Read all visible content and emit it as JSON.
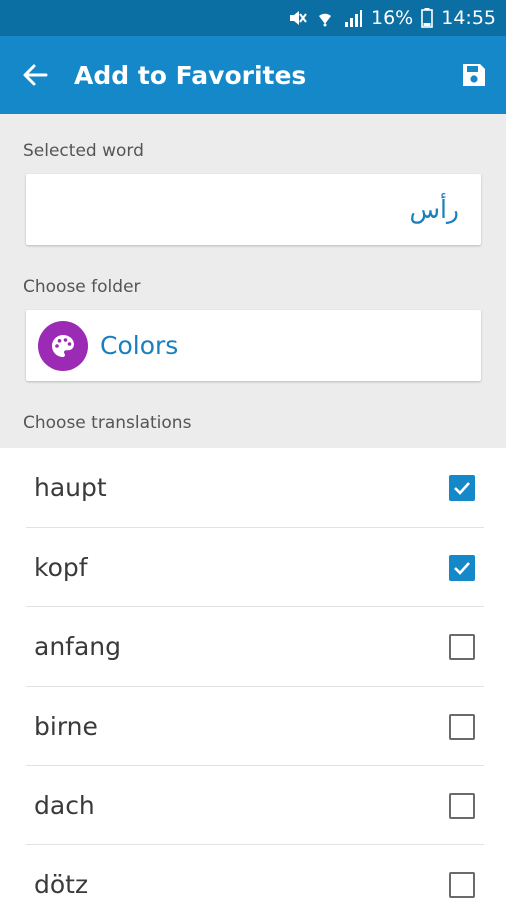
{
  "status_bar": {
    "battery": "16%",
    "time": "14:55"
  },
  "app_bar": {
    "title": "Add to Favorites"
  },
  "selected_word": {
    "label": "Selected word",
    "value": "رأس"
  },
  "folder": {
    "label": "Choose folder",
    "name": "Colors",
    "icon_color": "#9b2ab4"
  },
  "translations": {
    "label": "Choose translations",
    "items": [
      {
        "text": "haupt",
        "checked": true
      },
      {
        "text": "kopf",
        "checked": true
      },
      {
        "text": "anfang",
        "checked": false
      },
      {
        "text": "birne",
        "checked": false
      },
      {
        "text": "dach",
        "checked": false
      },
      {
        "text": "dötz",
        "checked": false
      }
    ]
  },
  "colors": {
    "status_bar": "#0b6fa4",
    "app_bar": "#1488c8",
    "accent_text": "#1a7fbe"
  }
}
